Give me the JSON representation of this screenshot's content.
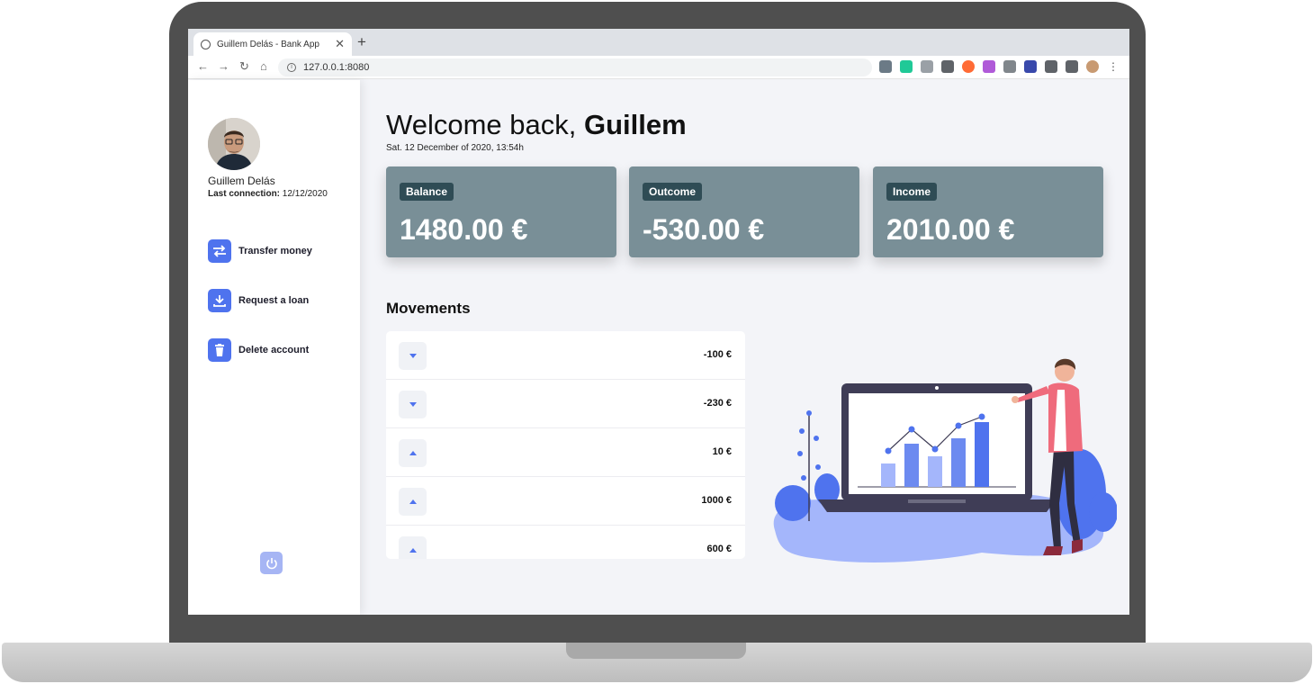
{
  "browser": {
    "tab_title": "Guillem Delás - Bank App",
    "tab_close": "✕",
    "new_tab": "+",
    "url": "127.0.0.1:8080"
  },
  "sidebar": {
    "user_name": "Guillem Delás",
    "last_connection_label": "Last connection:",
    "last_connection_value": "12/12/2020",
    "actions": [
      {
        "label": "Transfer money",
        "icon": "transfer-icon"
      },
      {
        "label": "Request a loan",
        "icon": "download-icon"
      },
      {
        "label": "Delete account",
        "icon": "trash-icon"
      }
    ],
    "logout_icon": "power-icon"
  },
  "header": {
    "welcome_prefix": "Welcome back,",
    "welcome_name": "Guillem",
    "date": "Sat. 12 December of 2020, 13:54h"
  },
  "cards": [
    {
      "label": "Balance",
      "amount": "1480.00 €"
    },
    {
      "label": "Outcome",
      "amount": "-530.00 €"
    },
    {
      "label": "Income",
      "amount": "2010.00 €"
    }
  ],
  "movements": {
    "title": "Movements",
    "items": [
      {
        "direction": "out",
        "amount": "-100 €"
      },
      {
        "direction": "out",
        "amount": "-230 €"
      },
      {
        "direction": "in",
        "amount": "10 €"
      },
      {
        "direction": "in",
        "amount": "1000 €"
      },
      {
        "direction": "in",
        "amount": "600 €"
      }
    ]
  },
  "colors": {
    "accent": "#4f73ee",
    "card_bg": "#798f97",
    "badge_bg": "#2f4c55",
    "page_bg": "#f3f4f8"
  }
}
